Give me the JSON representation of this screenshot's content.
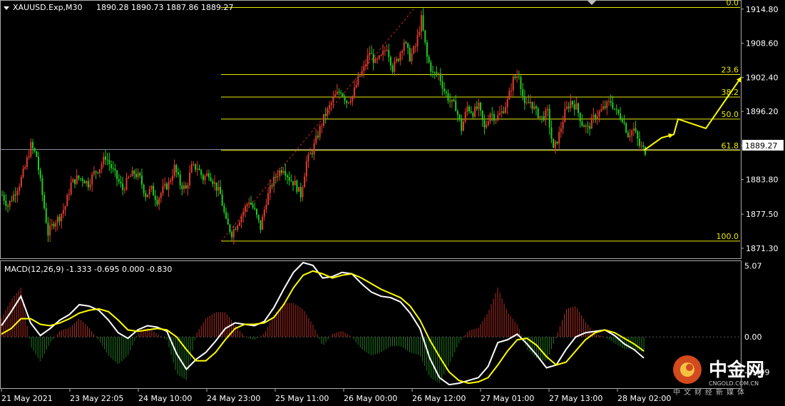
{
  "header": {
    "symbol_timeframe": "XAUUSD.Exp,M30",
    "ohlc": "1890.28 1890.73 1887.86 1889.27"
  },
  "macd_header": "MACD(12,26,9) -1.333 -0.695 0.000 -0.830",
  "current_price": "1889.27",
  "price_axis_labels": [
    "1914.80",
    "1908.60",
    "1902.40",
    "1896.20",
    "1890.00",
    "1883.80",
    "1877.50",
    "1871.30"
  ],
  "macd_axis_labels": [
    "5.07",
    "0.00",
    "-2.499"
  ],
  "time_axis_labels": [
    "21 May 2021",
    "23 May 22:05",
    "24 May 10:00",
    "24 May 23:00",
    "25 May 11:00",
    "26 May 00:00",
    "26 May 12:00",
    "27 May 01:00",
    "27 May 13:00",
    "28 May 02:00"
  ],
  "fib_labels": [
    "0.0",
    "23.6",
    "38.2",
    "50.0",
    "61.8",
    "100.0"
  ],
  "watermark": {
    "brand_cn": "中金网",
    "brand_en": "CNGOLD.COM.CN",
    "tagline": "中文财经新媒体"
  },
  "colors": {
    "bull": "#e33b2f",
    "bear": "#22cc22",
    "fib": "#e8e800",
    "arrow": "#ffff00",
    "macd_main": "#ffffff",
    "macd_signal": "#ffff00",
    "hist_pos": "#b22d22",
    "hist_neg": "#1f7a1f"
  },
  "chart_data": [
    {
      "type": "candlestick",
      "title": "XAUUSD.Exp,M30",
      "ylim": [
        1869.6,
        1916.2
      ],
      "x_ticks": [
        "21 May 2021",
        "23 May 22:05",
        "24 May 10:00",
        "24 May 23:00",
        "25 May 11:00",
        "26 May 00:00",
        "26 May 12:00",
        "27 May 01:00",
        "27 May 13:00",
        "28 May 02:00"
      ],
      "price_close_path": [
        1881,
        1879,
        1881,
        1883,
        1886,
        1890,
        1888,
        1881,
        1874,
        1876,
        1877,
        1879,
        1883,
        1884,
        1884,
        1883,
        1885,
        1886,
        1888,
        1886,
        1884,
        1882,
        1884,
        1885,
        1884,
        1881,
        1882,
        1880,
        1882,
        1883,
        1886,
        1883,
        1882,
        1886,
        1886,
        1884,
        1885,
        1883,
        1881,
        1876,
        1874,
        1876,
        1878,
        1880,
        1878,
        1875,
        1880,
        1883,
        1885,
        1886,
        1884,
        1883,
        1881,
        1887,
        1889,
        1892,
        1895,
        1897,
        1899,
        1900,
        1898,
        1899,
        1902,
        1904,
        1907,
        1905,
        1906,
        1908,
        1904,
        1906,
        1909,
        1906,
        1908,
        1913,
        1906,
        1903,
        1903,
        1900,
        1898,
        1897,
        1893,
        1897,
        1896,
        1897,
        1893,
        1896,
        1895,
        1896,
        1898,
        1902,
        1903,
        1897,
        1898,
        1896,
        1895,
        1896,
        1889,
        1892,
        1896,
        1898,
        1897,
        1894,
        1893,
        1895,
        1896,
        1897,
        1898,
        1896,
        1895,
        1892,
        1893,
        1890,
        1889
      ],
      "fibonacci": [
        {
          "level": "0.0",
          "price": 1915.1
        },
        {
          "level": "23.6",
          "price": 1902.9
        },
        {
          "level": "38.2",
          "price": 1898.8
        },
        {
          "level": "50.0",
          "price": 1894.8
        },
        {
          "level": "61.8",
          "price": 1889.1
        },
        {
          "level": "100.0",
          "price": 1872.6
        }
      ],
      "projection_arrow": [
        1889.1,
        1891.4,
        1892.0,
        1894.8,
        1893.1,
        1902.5
      ],
      "current_price": 1889.27
    },
    {
      "type": "line",
      "title": "MACD(12,26,9)",
      "ylim": [
        -3.6,
        5.3
      ],
      "series": [
        {
          "name": "MACD",
          "values": [
            0.8,
            1.8,
            2.9,
            1.0,
            0.1,
            0.6,
            1.2,
            1.6,
            2.3,
            2.2,
            1.9,
            1.2,
            0.3,
            -0.1,
            0.5,
            0.8,
            0.7,
            0.4,
            -1.2,
            -2.3,
            -1.6,
            -1.1,
            -0.3,
            0.6,
            1.0,
            0.9,
            0.8,
            1.1,
            2.1,
            3.4,
            4.6,
            5.3,
            5.1,
            4.2,
            4.3,
            4.6,
            4.5,
            3.8,
            3.2,
            2.9,
            2.8,
            2.5,
            1.7,
            0.6,
            -1.5,
            -2.9,
            -3.4,
            -3.3,
            -3.1,
            -2.9,
            -2.1,
            -0.4,
            -0.2,
            0.2,
            -0.5,
            -1.3,
            -2.2,
            -2.0,
            -0.9,
            0.0,
            0.3,
            0.4,
            0.5,
            0.1,
            -0.5,
            -0.9,
            -1.5
          ]
        },
        {
          "name": "Signal",
          "values": [
            0.2,
            0.6,
            1.3,
            1.3,
            0.9,
            0.8,
            1.0,
            1.3,
            1.7,
            1.9,
            2.0,
            1.8,
            1.2,
            0.5,
            0.4,
            0.5,
            0.6,
            0.5,
            0.0,
            -0.9,
            -1.7,
            -1.7,
            -1.1,
            -0.2,
            0.6,
            0.9,
            0.9,
            1.0,
            1.4,
            2.3,
            3.5,
            4.4,
            4.7,
            4.5,
            4.2,
            4.4,
            4.5,
            4.2,
            3.8,
            3.4,
            3.1,
            2.8,
            2.2,
            1.2,
            -0.2,
            -1.4,
            -2.5,
            -3.1,
            -3.3,
            -3.2,
            -2.9,
            -2.0,
            -1.0,
            -0.2,
            -0.1,
            -0.6,
            -1.4,
            -2.0,
            -1.8,
            -1.0,
            -0.2,
            0.3,
            0.5,
            0.3,
            -0.1,
            -0.5,
            -1.0
          ]
        }
      ]
    }
  ]
}
